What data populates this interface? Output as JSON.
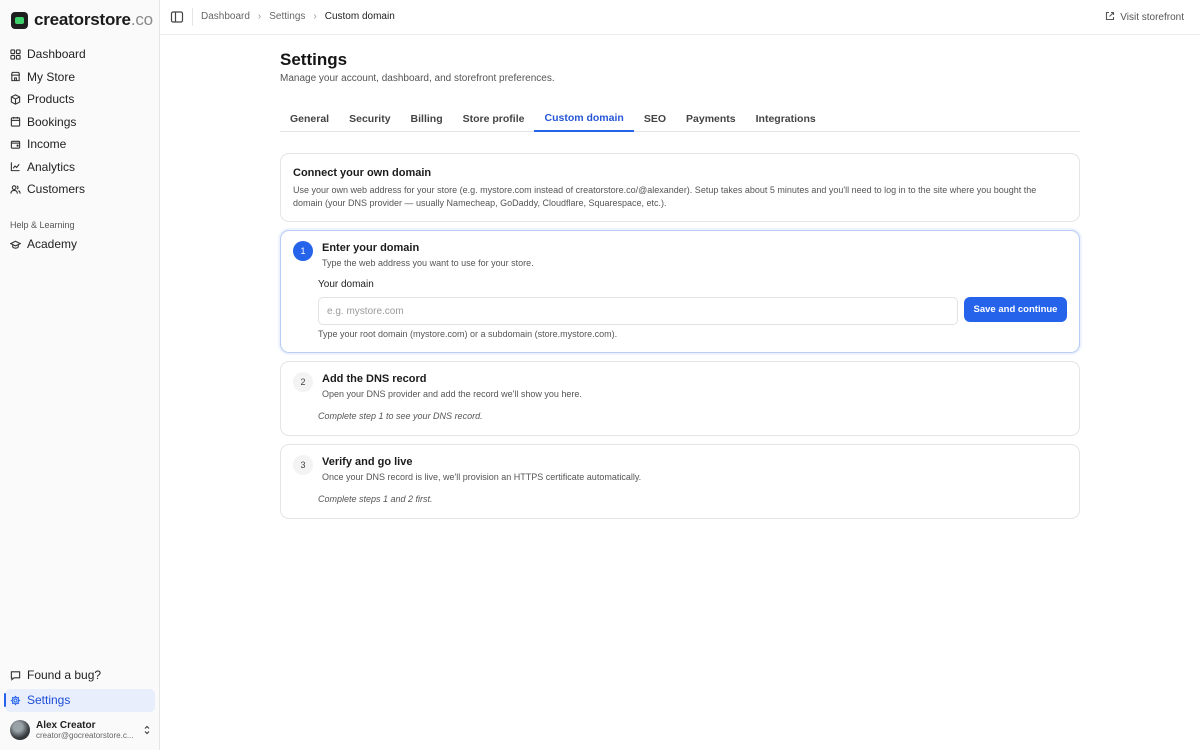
{
  "brand": {
    "name": "creatorstore",
    "tld": ".co"
  },
  "sidebar": {
    "items": [
      {
        "label": "Dashboard",
        "icon": "grid-icon"
      },
      {
        "label": "My Store",
        "icon": "store-icon"
      },
      {
        "label": "Products",
        "icon": "box-icon"
      },
      {
        "label": "Bookings",
        "icon": "calendar-icon"
      },
      {
        "label": "Income",
        "icon": "wallet-icon"
      },
      {
        "label": "Analytics",
        "icon": "chart-icon"
      },
      {
        "label": "Customers",
        "icon": "users-icon"
      }
    ],
    "section_label": "Help & Learning",
    "learning_items": [
      {
        "label": "Academy",
        "icon": "graduation-cap-icon"
      }
    ],
    "bottom_items": [
      {
        "label": "Found a bug?",
        "icon": "message-icon"
      },
      {
        "label": "Settings",
        "icon": "gear-icon",
        "active": true
      }
    ],
    "user": {
      "name": "Alex Creator",
      "email": "creator@gocreatorstore.c..."
    }
  },
  "topbar": {
    "breadcrumb": [
      "Dashboard",
      "Settings",
      "Custom domain"
    ],
    "visit_label": "Visit storefront"
  },
  "page": {
    "title": "Settings",
    "subtitle": "Manage your account, dashboard, and storefront preferences.",
    "tabs": [
      "General",
      "Security",
      "Billing",
      "Store profile",
      "Custom domain",
      "SEO",
      "Payments",
      "Integrations"
    ],
    "active_tab": "Custom domain"
  },
  "intro": {
    "title": "Connect your own domain",
    "description": "Use your own web address for your store (e.g. mystore.com instead of creatorstore.co/@alexander). Setup takes about 5 minutes and you'll need to log in to the site where you bought the domain (your DNS provider — usually Namecheap, GoDaddy, Cloudflare, Squarespace, etc.)."
  },
  "steps": [
    {
      "number": "1",
      "title": "Enter your domain",
      "subtitle": "Type the web address you want to use for your store.",
      "field_label": "Your domain",
      "placeholder": "e.g. mystore.com",
      "value": "",
      "button_label": "Save and continue",
      "helper": "Type your root domain (mystore.com) or a subdomain (store.mystore.com)."
    },
    {
      "number": "2",
      "title": "Add the DNS record",
      "subtitle": "Open your DNS provider and add the record we'll show you here.",
      "note": "Complete step 1 to see your DNS record."
    },
    {
      "number": "3",
      "title": "Verify and go live",
      "subtitle": "Once your DNS record is live, we'll provision an HTTPS certificate automatically.",
      "note": "Complete steps 1 and 2 first."
    }
  ],
  "colors": {
    "accent": "#2563eb",
    "brand_green": "#3ecf6a"
  }
}
